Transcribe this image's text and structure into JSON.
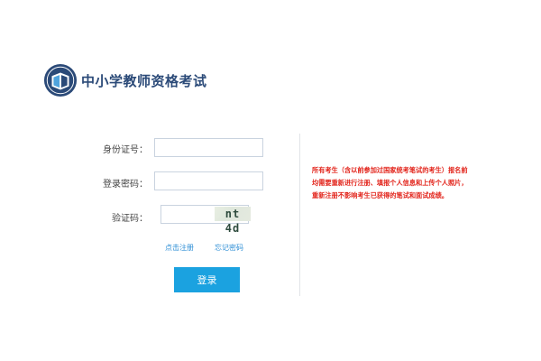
{
  "header": {
    "title": "中小学教师资格考试",
    "logo_icon": "exam-logo-icon"
  },
  "form": {
    "id_label": "身份证号：",
    "id_value": "",
    "password_label": "登录密码：",
    "password_value": "",
    "captcha_label": "验证码：",
    "captcha_value": "",
    "captcha_text": "nt 4d"
  },
  "links": {
    "register": "点击注册",
    "forgot_password": "忘记密码"
  },
  "buttons": {
    "login": "登录"
  },
  "notice": {
    "text": "所有考生（含以前参加过国家统考笔试的考生）报名前均需要重新进行注册、填报个人信息和上传个人照片，重新注册不影响考生已获得的笔试和面试成绩。"
  },
  "colors": {
    "brand": "#2b4a78",
    "accent": "#1ba2e0",
    "link": "#2f8fd6",
    "notice": "#e2231a"
  }
}
